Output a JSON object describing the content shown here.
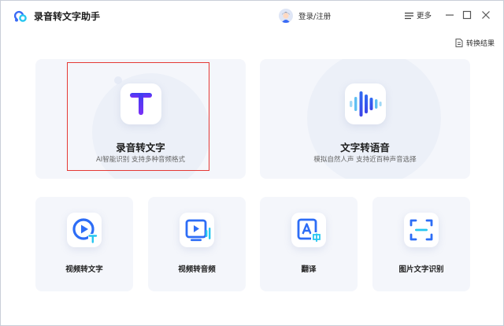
{
  "app": {
    "title": "录音转文字助手"
  },
  "account": {
    "label": "登录/注册"
  },
  "menu": {
    "more_label": "更多"
  },
  "toolbar": {
    "results_label": "转换结果"
  },
  "main_tools": [
    {
      "title": "录音转文字",
      "subtitle": "AI智能识别 支持多种音频格式",
      "icon": "letter-t-icon"
    },
    {
      "title": "文字转语音",
      "subtitle": "模拟自然人声 支持近百种声音选择",
      "icon": "sound-wave-icon"
    }
  ],
  "tools": [
    {
      "title": "视频转文字",
      "icon": "video-to-text-icon"
    },
    {
      "title": "视频转音频",
      "icon": "video-to-audio-icon"
    },
    {
      "title": "翻译",
      "icon": "translate-icon"
    },
    {
      "title": "图片文字识别",
      "icon": "image-text-recognition-icon"
    }
  ],
  "colors": {
    "accent": "#3a6bf5",
    "accent_light": "#26c6f0",
    "highlight_border": "#e53935",
    "card_bg": "#f4f6fb"
  }
}
